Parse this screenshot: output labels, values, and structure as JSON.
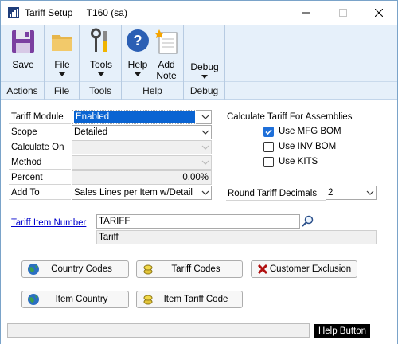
{
  "window": {
    "title": "Tariff Setup",
    "subtitle": "T160 (sa)"
  },
  "ribbon": {
    "groups": [
      {
        "label": "Actions",
        "buttons": [
          {
            "label": "Save"
          }
        ]
      },
      {
        "label": "File",
        "buttons": [
          {
            "label": "File"
          }
        ]
      },
      {
        "label": "Tools",
        "buttons": [
          {
            "label": "Tools"
          }
        ]
      },
      {
        "label": "Help",
        "buttons": [
          {
            "label": "Help"
          },
          {
            "label": "Add",
            "label2": "Note"
          }
        ]
      },
      {
        "label": "Debug",
        "buttons": [
          {
            "label": "Debug"
          }
        ]
      }
    ]
  },
  "form": {
    "tariff_module": {
      "label": "Tariff Module",
      "value": "Enabled"
    },
    "scope": {
      "label": "Scope",
      "value": "Detailed"
    },
    "calculate_on": {
      "label": "Calculate On",
      "value": ""
    },
    "method": {
      "label": "Method",
      "value": ""
    },
    "percent": {
      "label": "Percent",
      "value": "0.00%"
    },
    "add_to": {
      "label": "Add To",
      "value": "Sales Lines per Item w/Detail"
    },
    "assemblies": {
      "heading": "Calculate Tariff For Assemblies",
      "use_mfg_bom": {
        "label": "Use MFG BOM",
        "checked": true
      },
      "use_inv_bom": {
        "label": "Use INV BOM",
        "checked": false
      },
      "use_kits": {
        "label": "Use KITS",
        "checked": false
      }
    },
    "round_decimals": {
      "label": "Round Tariff Decimals",
      "value": "2"
    },
    "tariff_item": {
      "label": "Tariff Item Number",
      "value": "TARIFF",
      "description": "Tariff"
    }
  },
  "buttons": {
    "country_codes": "Country Codes",
    "tariff_codes": "Tariff Codes",
    "customer_exclusion": "Customer Exclusion",
    "item_country": "Item Country",
    "item_tariff_code": "Item Tariff Code"
  },
  "footer": {
    "help_button": "Help Button"
  }
}
